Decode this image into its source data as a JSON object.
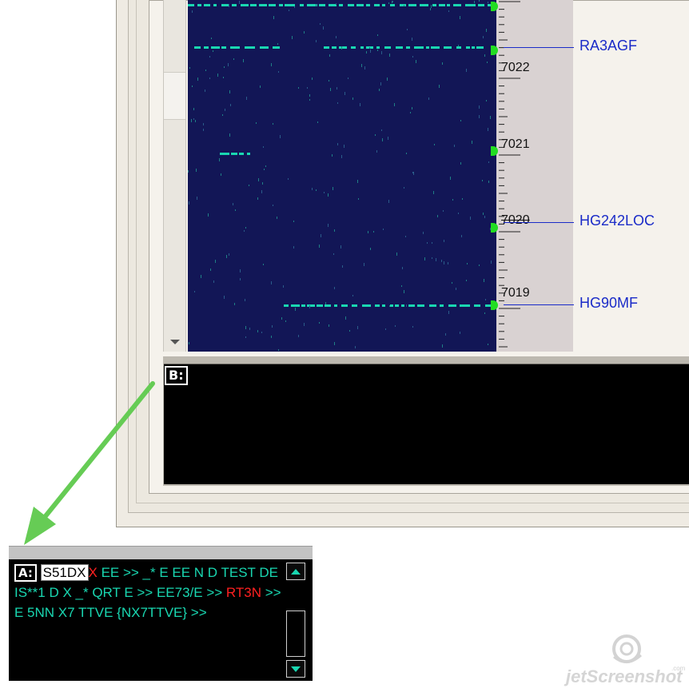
{
  "colors": {
    "waterfall_bg": "#121656",
    "signal": "#19d7b1",
    "marker": "#22dd22",
    "callsign": "#1a2bc8",
    "ruler_bg": "#d9d2d2",
    "decoded_text": "#19d7b1",
    "error_text": "#ff2020",
    "arrow": "#66cc55"
  },
  "ruler": {
    "labels": [
      "7022",
      "7021",
      "7020",
      "7019"
    ]
  },
  "spots": [
    {
      "callsign": "RA3AGF"
    },
    {
      "callsign": "HG242LOC"
    },
    {
      "callsign": "HG90MF"
    }
  ],
  "panel_b": {
    "tag": "B:"
  },
  "panel_a": {
    "tag": "A:",
    "callsign": "S51DX",
    "segments": [
      {
        "text": "X",
        "style": "red"
      },
      {
        "text": " EE  >> _* E EE N D TEST DE IS**1 D X _* QRT E  >> EE73/E  >> ",
        "style": "normal"
      },
      {
        "text": "RT3N",
        "style": "red"
      },
      {
        "text": "  >> E 5NN X7 TTVE  {NX7TTVE} >>",
        "style": "normal"
      }
    ],
    "scroll_up_icon": "up-arrow-icon",
    "scroll_down_icon": "down-arrow-icon"
  },
  "watermark": {
    "text": "jetScreenshot",
    "suffix": ".com"
  }
}
